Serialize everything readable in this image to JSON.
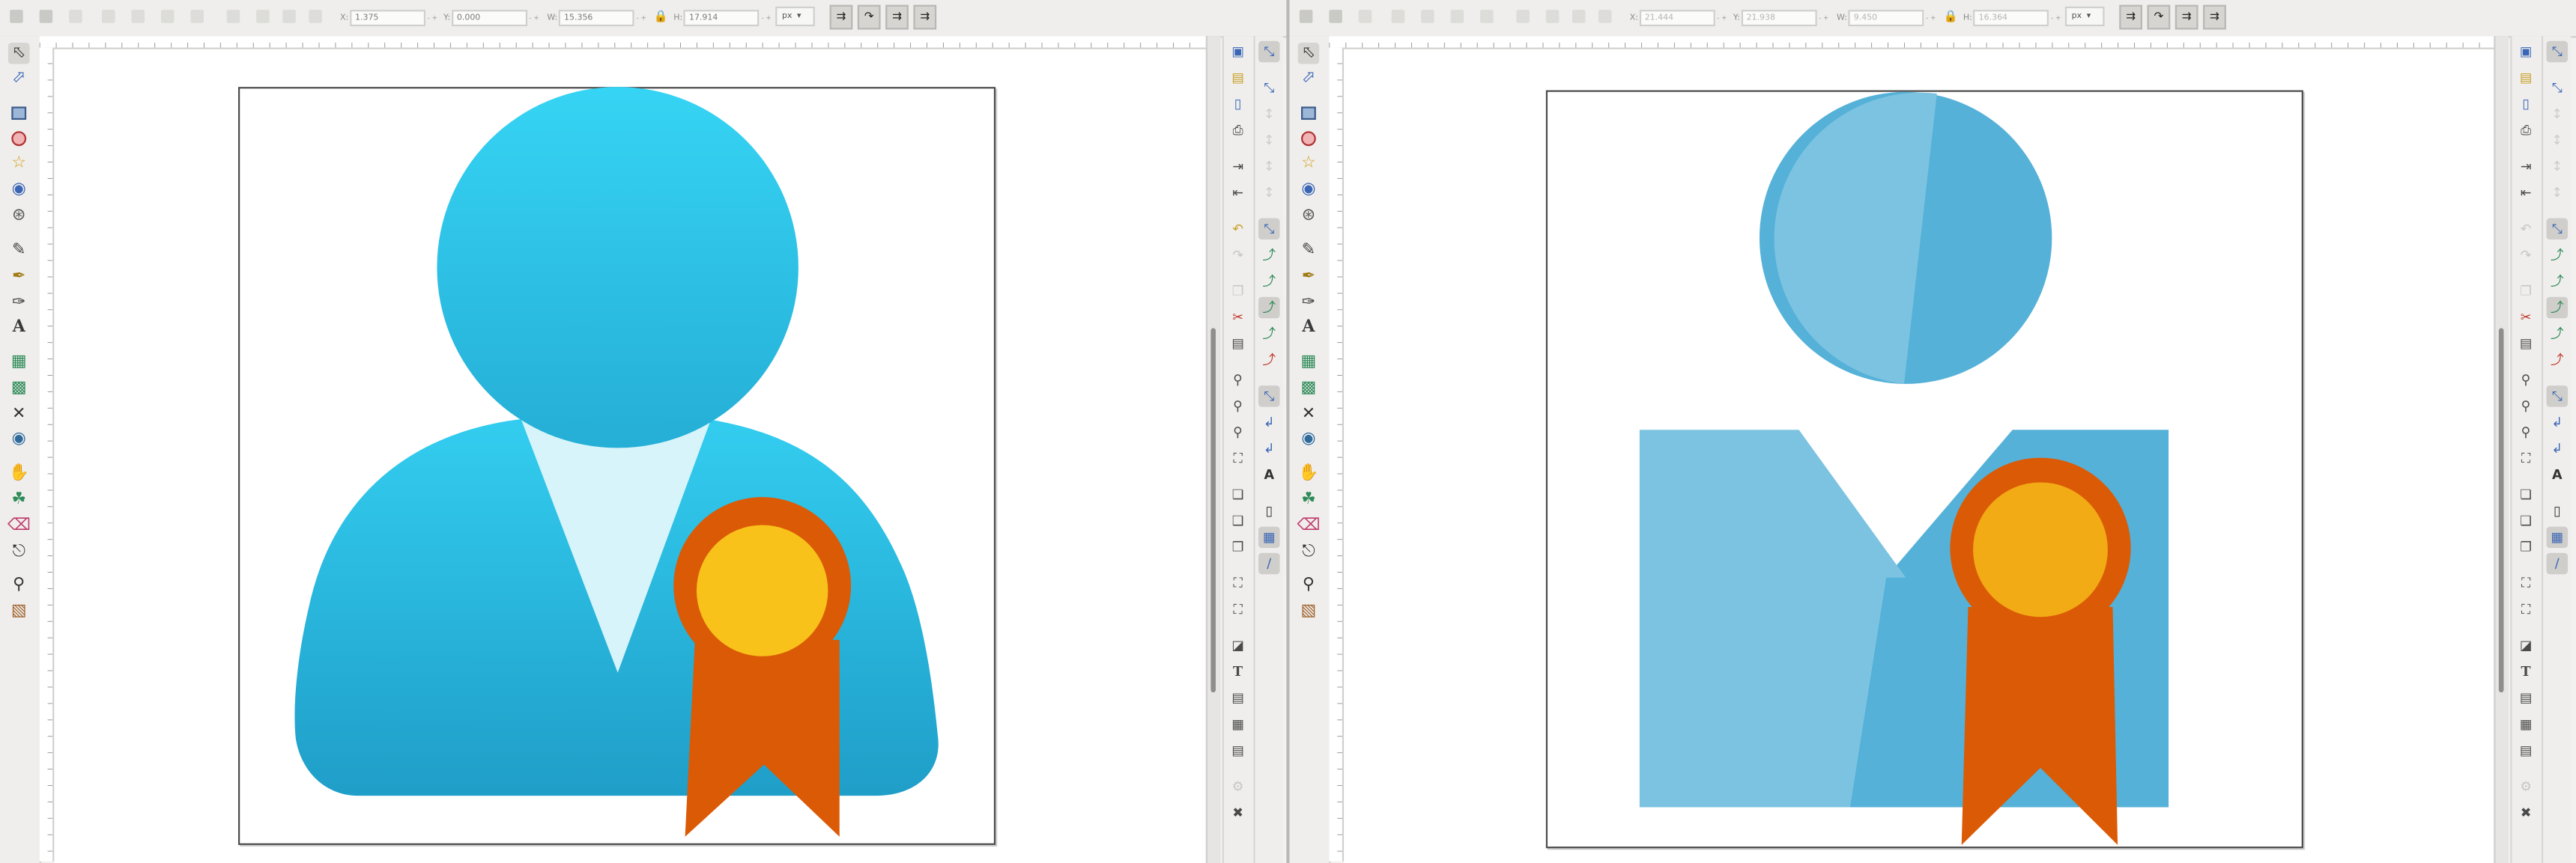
{
  "left_window": {
    "controls": {
      "x_label": "X:",
      "x_value": "1.375",
      "y_label": "Y:",
      "y_value": "0.000",
      "w_label": "W:",
      "w_value": "15.356",
      "h_label": "H:",
      "h_value": "17.914",
      "unit": "px"
    },
    "artwork": {
      "head_gradient_top": "#36d4f4",
      "head_gradient_bottom": "#25aed6",
      "body_gradient_top": "#33cdf0",
      "body_gradient_bottom": "#1f9ec8",
      "shirt_color": "#d6f4fa",
      "badge_ribbon_color": "#db5a06",
      "badge_center_color": "#f8c21a"
    }
  },
  "right_window": {
    "controls": {
      "x_label": "X:",
      "x_value": "21.444",
      "y_label": "Y:",
      "y_value": "21.938",
      "w_label": "W:",
      "w_value": "9.450",
      "h_label": "H:",
      "h_value": "16.364",
      "unit": "px"
    },
    "artwork": {
      "light_blue": "#7cc3e1",
      "dark_blue": "#55b1d8",
      "badge_ribbon_color": "#db5a06",
      "badge_center_color": "#f2ab14"
    }
  },
  "toolbox_icons": [
    "selector-icon",
    "node-icon",
    "rect-icon",
    "ellipse-icon",
    "star-icon",
    "3dbox-icon",
    "spiral-icon",
    "pencil-icon",
    "pen-icon",
    "calligraphy-icon",
    "text-icon",
    "gradient-icon",
    "mesh-icon",
    "dropper-icon",
    "paint-bucket-icon",
    "tweak-icon",
    "spray-icon",
    "eraser-icon",
    "connector-icon",
    "zoom-icon",
    "measure-icon"
  ],
  "commands_icons": [
    "new-icon",
    "open-icon",
    "save-icon",
    "print-icon",
    "import-icon",
    "export-icon",
    "undo-icon",
    "redo-icon",
    "copy-icon",
    "cut-icon",
    "paste-icon",
    "zoom-selection-icon",
    "zoom-drawing-icon",
    "zoom-page-icon",
    "zoom-width-icon",
    "duplicate-icon",
    "clone-icon",
    "unlink-clone-icon",
    "group-icon",
    "ungroup-icon",
    "fill-stroke-icon",
    "text-font-icon",
    "layers-icon",
    "xml-editor-icon",
    "align-icon",
    "preferences-icon",
    "transform-icon"
  ],
  "snap_icons": [
    "snap-enable-icon",
    "snap-bbox-icon",
    "snap-bbox-edge-icon",
    "snap-bbox-corner-icon",
    "snap-nodes-icon",
    "snap-path-icon",
    "snap-cusp-icon",
    "snap-smooth-icon",
    "snap-midpoint-icon",
    "snap-center-icon",
    "snap-rotation-icon",
    "snap-text-baseline-icon",
    "snap-page-icon",
    "snap-grid-icon",
    "snap-guide-icon"
  ]
}
